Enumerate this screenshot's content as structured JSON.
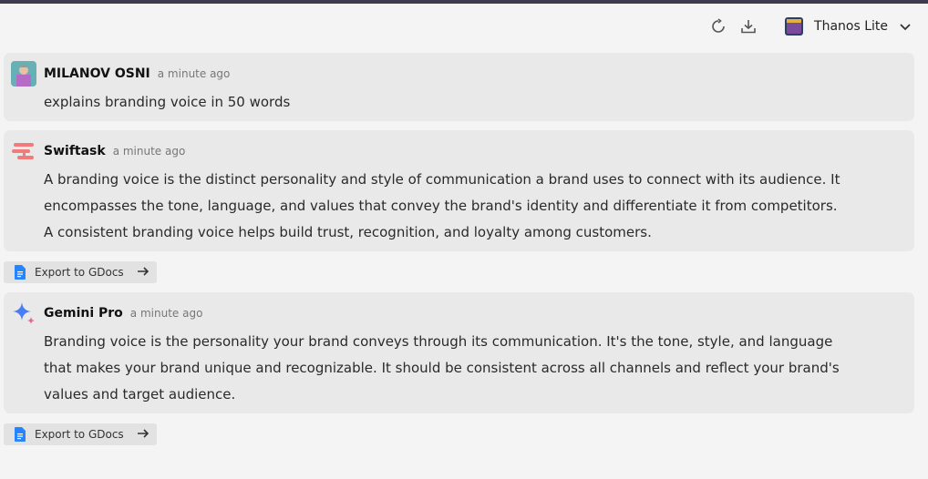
{
  "toolbar": {
    "model_name": "Thanos Lite",
    "icons": [
      "refresh-icon",
      "download-icon",
      "chevron-down-icon"
    ]
  },
  "messages": [
    {
      "author": "MILANOV OSNI",
      "time": "a minute ago",
      "text": "explains branding voice in 50 words"
    },
    {
      "author": "Swiftask",
      "time": "a minute ago",
      "text": "A branding voice is the distinct personality and style of communication a brand uses to connect with its audience. It encompasses the tone, language, and values that convey the brand's identity and differentiate it from competitors. A consistent branding voice helps build trust, recognition, and loyalty among customers."
    },
    {
      "author": "Gemini Pro",
      "time": "a minute ago",
      "text": "Branding voice is the personality your brand conveys through its communication. It's the tone, style, and language that makes your brand unique and recognizable. It should be consistent across all channels and reflect your brand's values and target audience."
    }
  ],
  "export_label": "Export to GDocs",
  "colors": {
    "card_bg": "#e9e9e9",
    "export_bg": "#e2e2e2",
    "swiftask_accent": "#f27a7a",
    "gdocs_blue": "#2684fc",
    "gemini_blue": "#4a7cf7",
    "gemini_pink": "#e86a8a"
  }
}
